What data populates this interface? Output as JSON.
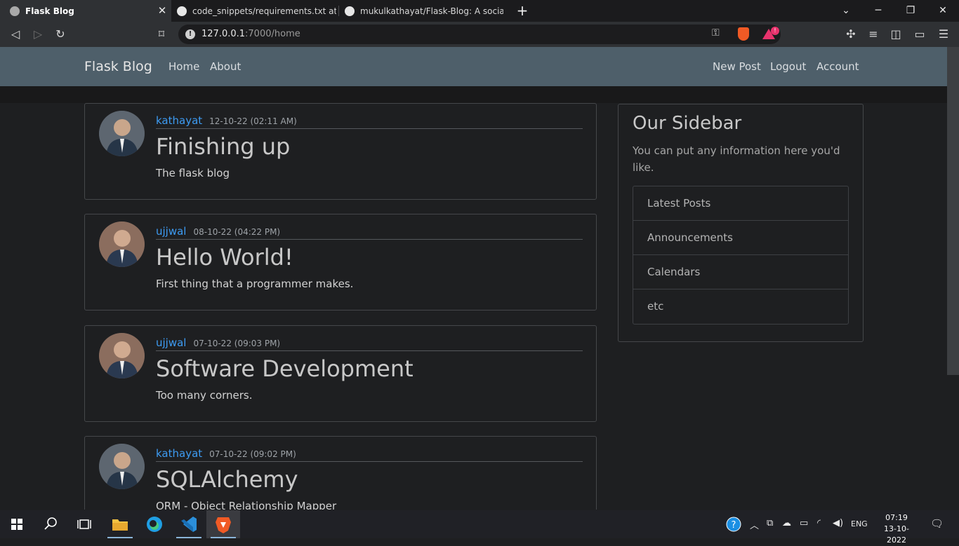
{
  "browser": {
    "tabs": [
      {
        "label": "Flask Blog",
        "active": true
      },
      {
        "label": "code_snippets/requirements.txt at ma",
        "active": false
      },
      {
        "label": "mukulkathayat/Flask-Blog: A social me",
        "active": false
      }
    ],
    "url_host": "127.0.0.1",
    "url_path": ":7000/home"
  },
  "navbar": {
    "brand": "Flask Blog",
    "left_links": [
      "Home",
      "About"
    ],
    "right_links": [
      "New Post",
      "Logout",
      "Account"
    ]
  },
  "posts": [
    {
      "author": "kathayat",
      "date": "12-10-22 (02:11 AM)",
      "title": "Finishing up",
      "body": "The flask blog"
    },
    {
      "author": "ujjwal",
      "date": "08-10-22 (04:22 PM)",
      "title": "Hello World!",
      "body": "First thing that a programmer makes."
    },
    {
      "author": "ujjwal",
      "date": "07-10-22 (09:03 PM)",
      "title": "Software Development",
      "body": "Too many corners."
    },
    {
      "author": "kathayat",
      "date": "07-10-22 (09:02 PM)",
      "title": "SQLAlchemy",
      "body": "ORM - Object Relationship Mapper"
    }
  ],
  "sidebar": {
    "title": "Our Sidebar",
    "description": "You can put any information here you'd like.",
    "items": [
      "Latest Posts",
      "Announcements",
      "Calendars",
      "etc"
    ]
  },
  "taskbar": {
    "language": "ENG",
    "time": "07:19",
    "date": "13-10-2022"
  },
  "colors": {
    "navbar": "#4e5f6a",
    "author_link": "#3d9bf2",
    "page_bg": "#1e1f21"
  }
}
